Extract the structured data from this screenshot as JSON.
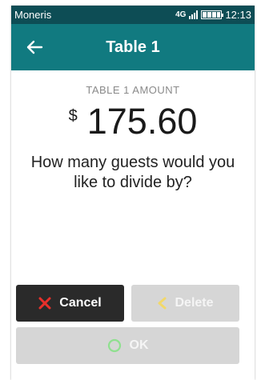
{
  "status_bar": {
    "carrier": "Moneris",
    "network": "4G",
    "time": "12:13",
    "icons": [
      "signal-icon",
      "battery-icon"
    ]
  },
  "header": {
    "title": "Table 1",
    "back_icon": "back-arrow-icon"
  },
  "main": {
    "amount_label": "TABLE 1 AMOUNT",
    "currency_symbol": "$",
    "amount": "175.60",
    "prompt": "How many guests would you like to divide by?"
  },
  "buttons": {
    "cancel_label": "Cancel",
    "delete_label": "Delete",
    "ok_label": "OK"
  },
  "colors": {
    "status_bar": "#0d4d55",
    "header": "#117a80",
    "cancel_bg": "#2a2a2a",
    "disabled_bg": "#d6d6d6",
    "cancel_icon": "#e8302b",
    "delete_icon": "#f2d86a",
    "ok_icon": "#8fe08f"
  }
}
